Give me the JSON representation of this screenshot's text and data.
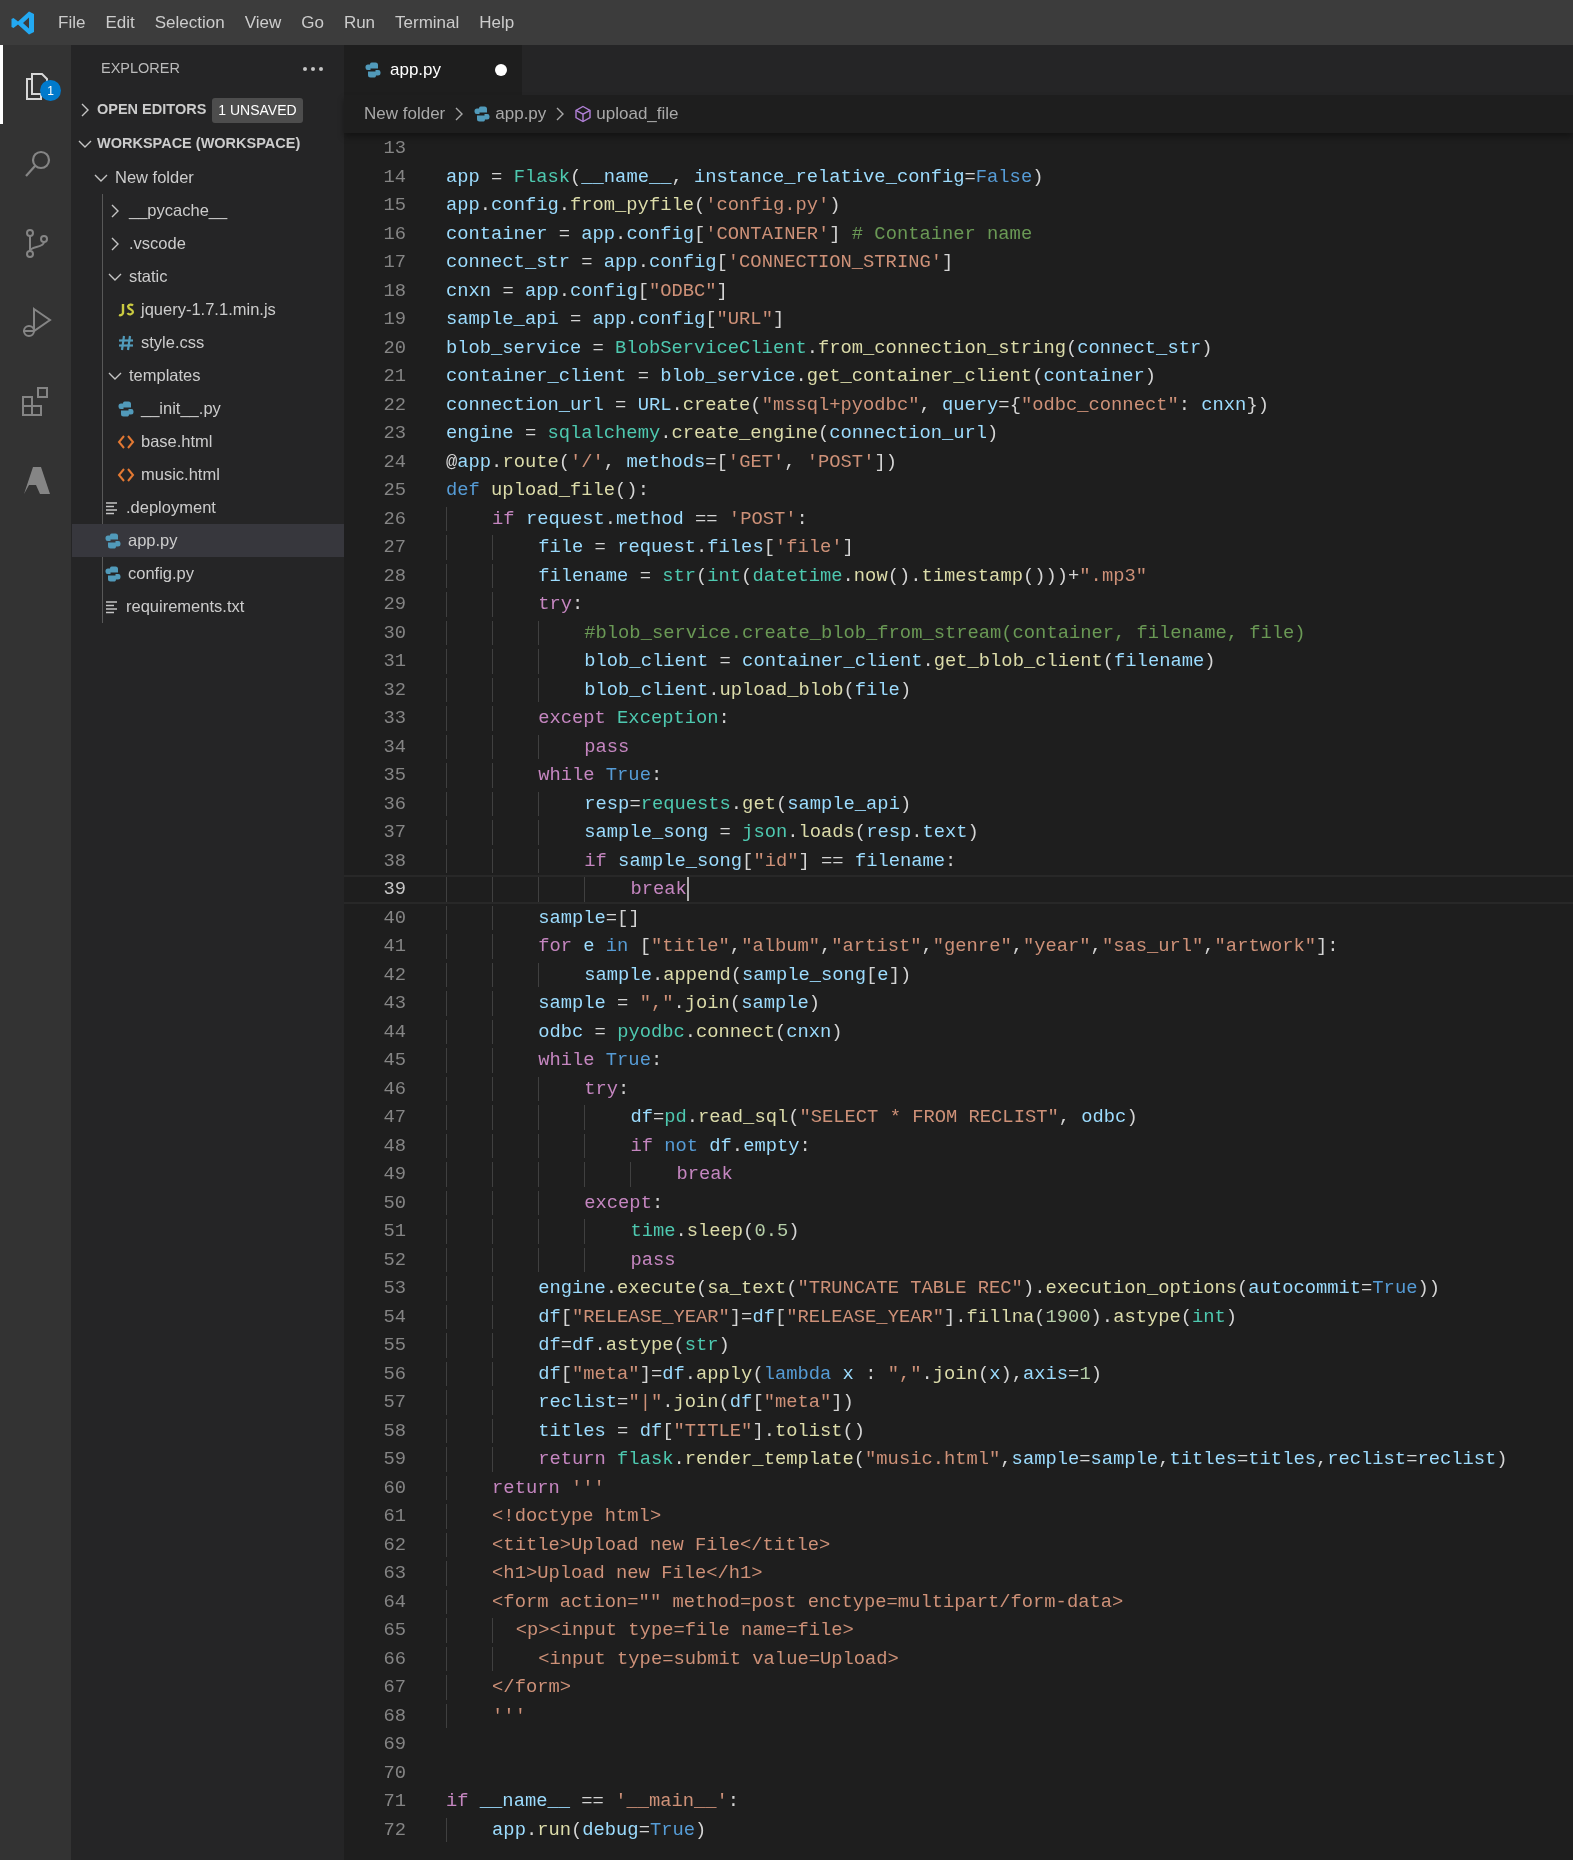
{
  "menu": [
    "File",
    "Edit",
    "Selection",
    "View",
    "Go",
    "Run",
    "Terminal",
    "Help"
  ],
  "activity_bar": [
    {
      "kind": "explorer",
      "selected": true,
      "badge": "1"
    },
    {
      "kind": "search",
      "selected": false
    },
    {
      "kind": "source-control",
      "selected": false
    },
    {
      "kind": "run-debug",
      "selected": false
    },
    {
      "kind": "extensions",
      "selected": false
    },
    {
      "kind": "azure",
      "selected": false
    }
  ],
  "explorer": {
    "title": "EXPLORER",
    "sections": [
      {
        "label": "OPEN EDITORS",
        "expanded": false,
        "badge": "1 UNSAVED"
      },
      {
        "label": "WORKSPACE (WORKSPACE)",
        "expanded": true,
        "items": [
          {
            "label": "New folder",
            "kind": "folder",
            "expanded": true,
            "selected": false,
            "children": [
              {
                "label": "__pycache__",
                "kind": "folder",
                "expanded": false,
                "selected": false
              },
              {
                "label": ".vscode",
                "kind": "folder",
                "expanded": false,
                "selected": false
              },
              {
                "label": "static",
                "kind": "folder",
                "expanded": true,
                "selected": false,
                "children": [
                  {
                    "label": "jquery-1.7.1.min.js",
                    "kind": "js",
                    "selected": false
                  },
                  {
                    "label": "style.css",
                    "kind": "css",
                    "selected": false
                  }
                ]
              },
              {
                "label": "templates",
                "kind": "folder",
                "expanded": true,
                "selected": false,
                "children": [
                  {
                    "label": "__init__.py",
                    "kind": "python",
                    "selected": false
                  },
                  {
                    "label": "base.html",
                    "kind": "html",
                    "selected": false
                  },
                  {
                    "label": "music.html",
                    "kind": "html",
                    "selected": false
                  }
                ]
              },
              {
                "label": ".deployment",
                "kind": "text",
                "selected": false
              },
              {
                "label": "app.py",
                "kind": "python",
                "selected": true
              },
              {
                "label": "config.py",
                "kind": "python",
                "selected": false
              },
              {
                "label": "requirements.txt",
                "kind": "text",
                "selected": false
              }
            ]
          }
        ]
      }
    ]
  },
  "tabs": [
    {
      "label": "app.py",
      "kind": "python",
      "selected": true,
      "modified": true
    }
  ],
  "breadcrumbs": [
    {
      "label": "New folder",
      "kind": "folder"
    },
    {
      "label": "app.py",
      "kind": "python"
    },
    {
      "label": "upload_file",
      "kind": "symbol"
    }
  ],
  "code": [
    {
      "number": "13",
      "active": false
    },
    {
      "number": "14",
      "active": false,
      "text": "app = Flask(__name__, instance_relative_config=False)"
    },
    {
      "number": "15",
      "active": false,
      "text": "app.config.from_pyfile('config.py')"
    },
    {
      "number": "16",
      "active": false,
      "text": "container = app.config['CONTAINER'] # Container name"
    },
    {
      "number": "17",
      "active": false,
      "text": "connect_str = app.config['CONNECTION_STRING']"
    },
    {
      "number": "18",
      "active": false,
      "text": "cnxn = app.config[\"ODBC\"]"
    },
    {
      "number": "19",
      "active": false,
      "text": "sample_api = app.config[\"URL\"]"
    },
    {
      "number": "20",
      "active": false,
      "text": "blob_service = BlobServiceClient.from_connection_string(connect_str)"
    },
    {
      "number": "21",
      "active": false,
      "text": "container_client = blob_service.get_container_client(container)"
    },
    {
      "number": "22",
      "active": false,
      "text": "connection_url = URL.create(\"mssql+pyodbc\", query={\"odbc_connect\": cnxn})"
    },
    {
      "number": "23",
      "active": false,
      "text": "engine = sqlalchemy.create_engine(connection_url)"
    },
    {
      "number": "24",
      "active": false,
      "text": "@app.route('/', methods=['GET', 'POST'])"
    },
    {
      "number": "25",
      "active": false,
      "text": "def upload_file():"
    },
    {
      "number": "26",
      "active": false,
      "text": "    if request.method == 'POST':"
    },
    {
      "number": "27",
      "active": false,
      "text": "        file = request.files['file']"
    },
    {
      "number": "28",
      "active": false,
      "text": "        filename = str(int(datetime.now().timestamp()))+\".mp3\""
    },
    {
      "number": "29",
      "active": false,
      "text": "        try:"
    },
    {
      "number": "30",
      "active": false,
      "text": "            #blob_service.create_blob_from_stream(container, filename, file)"
    },
    {
      "number": "31",
      "active": false,
      "text": "            blob_client = container_client.get_blob_client(filename)"
    },
    {
      "number": "32",
      "active": false,
      "text": "            blob_client.upload_blob(file)"
    },
    {
      "number": "33",
      "active": false,
      "text": "        except Exception:"
    },
    {
      "number": "34",
      "active": false,
      "text": "            pass"
    },
    {
      "number": "35",
      "active": false,
      "text": "        while True:"
    },
    {
      "number": "36",
      "active": false,
      "text": "            resp=requests.get(sample_api)"
    },
    {
      "number": "37",
      "active": false,
      "text": "            sample_song = json.loads(resp.text)"
    },
    {
      "number": "38",
      "active": false,
      "text": "            if sample_song[\"id\"] == filename:"
    },
    {
      "number": "39",
      "active": true,
      "text": "                break"
    },
    {
      "number": "40",
      "active": false,
      "text": "        sample=[]"
    },
    {
      "number": "41",
      "active": false,
      "text": "        for e in [\"title\",\"album\",\"artist\",\"genre\",\"year\",\"sas_url\",\"artwork\"]:"
    },
    {
      "number": "42",
      "active": false,
      "text": "            sample.append(sample_song[e])"
    },
    {
      "number": "43",
      "active": false,
      "text": "        sample = \",\".join(sample)"
    },
    {
      "number": "44",
      "active": false,
      "text": "        odbc = pyodbc.connect(cnxn)"
    },
    {
      "number": "45",
      "active": false,
      "text": "        while True:"
    },
    {
      "number": "46",
      "active": false,
      "text": "            try:"
    },
    {
      "number": "47",
      "active": false,
      "text": "                df=pd.read_sql(\"SELECT * FROM RECLIST\", odbc)"
    },
    {
      "number": "48",
      "active": false,
      "text": "                if not df.empty:"
    },
    {
      "number": "49",
      "active": false,
      "text": "                    break"
    },
    {
      "number": "50",
      "active": false,
      "text": "            except:"
    },
    {
      "number": "51",
      "active": false,
      "text": "                time.sleep(0.5)"
    },
    {
      "number": "52",
      "active": false,
      "text": "                pass"
    },
    {
      "number": "53",
      "active": false,
      "text": "        engine.execute(sa_text(\"TRUNCATE TABLE REC\").execution_options(autocommit=True))"
    },
    {
      "number": "54",
      "active": false,
      "text": "        df[\"RELEASE_YEAR\"]=df[\"RELEASE_YEAR\"].fillna(1900).astype(int)"
    },
    {
      "number": "55",
      "active": false,
      "text": "        df=df.astype(str)"
    },
    {
      "number": "56",
      "active": false,
      "text": "        df[\"meta\"]=df.apply(lambda x : \",\".join(x),axis=1)"
    },
    {
      "number": "57",
      "active": false,
      "text": "        reclist=\"|\".join(df[\"meta\"])"
    },
    {
      "number": "58",
      "active": false,
      "text": "        titles = df[\"TITLE\"].tolist()"
    },
    {
      "number": "59",
      "active": false,
      "text": "        return flask.render_template(\"music.html\",sample=sample,titles=titles,reclist=reclist)"
    },
    {
      "number": "60",
      "active": false,
      "text": "    return '''"
    },
    {
      "number": "61",
      "active": false,
      "text": "    <!doctype html>"
    },
    {
      "number": "62",
      "active": false,
      "text": "    <title>Upload new File</title>"
    },
    {
      "number": "63",
      "active": false,
      "text": "    <h1>Upload new File</h1>"
    },
    {
      "number": "64",
      "active": false,
      "text": "    <form action=\"\" method=post enctype=multipart/form-data>"
    },
    {
      "number": "65",
      "active": false,
      "text": "      <p><input type=file name=file>"
    },
    {
      "number": "66",
      "active": false,
      "text": "        <input type=submit value=Upload>"
    },
    {
      "number": "67",
      "active": false,
      "text": "    </form>"
    },
    {
      "number": "68",
      "active": false,
      "text": "    '''"
    },
    {
      "number": "69",
      "active": false
    },
    {
      "number": "70",
      "active": false
    },
    {
      "number": "71",
      "active": false,
      "text": "if __name__ == '__main__':"
    },
    {
      "number": "72",
      "active": false,
      "text": "    app.run(debug=True)"
    }
  ]
}
